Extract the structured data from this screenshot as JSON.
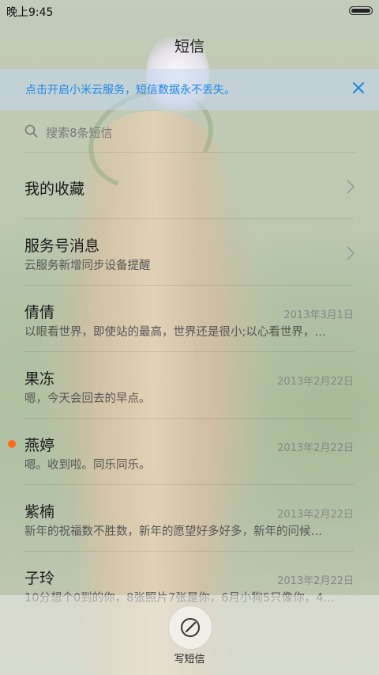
{
  "status_bar": {
    "time": "晚上9:45"
  },
  "header": {
    "title": "短信"
  },
  "banner": {
    "text": "点击开启小米云服务，短信数据永不丢失。",
    "accent": "#1e88e5"
  },
  "search": {
    "placeholder": "搜索8条短信"
  },
  "sections": [
    {
      "name": "我的收藏"
    },
    {
      "name": "服务号消息",
      "preview": "云服务新增同步设备提醒"
    }
  ],
  "conversations": [
    {
      "name": "倩倩",
      "date": "2013年3月1日",
      "preview": "以眼看世界，即使站的最高，世界还是很小;以心看世界，…",
      "unread": false
    },
    {
      "name": "果冻",
      "date": "2013年2月22日",
      "preview": "嗯，今天会回去的早点。",
      "unread": false
    },
    {
      "name": "燕婷",
      "date": "2013年2月22日",
      "preview": "嗯。收到啦。同乐同乐。",
      "unread": true
    },
    {
      "name": "紫楠",
      "date": "2013年2月22日",
      "preview": "新年的祝福数不胜数，新年的愿望好多好多，新年的问候…",
      "unread": false
    },
    {
      "name": "子玲",
      "date": "2013年2月22日",
      "preview": "10分想个0到的你，8张照片7张是你，6月小狗5只像你，4…",
      "unread": false
    }
  ],
  "compose": {
    "label": "写短信"
  },
  "colors": {
    "unread_dot": "#ff6b1a"
  }
}
